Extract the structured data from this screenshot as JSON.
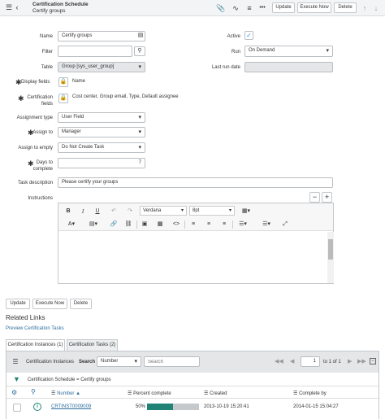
{
  "header": {
    "menu_icon": "hamburger-icon",
    "back_icon": "chevron-left-icon",
    "title": "Certification Schedule",
    "subtitle": "Certify groups",
    "icons": [
      "paperclip-icon",
      "activity-icon",
      "sliders-icon",
      "more-icon"
    ],
    "update_label": "Update",
    "execute_label": "Execute Now",
    "delete_label": "Delete"
  },
  "form": {
    "name_label": "Name",
    "name_value": "Certify groups",
    "active_label": "Active",
    "active_checked": true,
    "filter_label": "Filter",
    "filter_value": "",
    "run_label": "Run",
    "run_value": "On Demand",
    "table_label": "Table",
    "table_value": "Group [sys_user_group]",
    "last_run_label": "Last run date",
    "last_run_value": "",
    "display_fields_label": "Display fields",
    "display_fields_value": "Name",
    "cert_fields_label_1": "Certification",
    "cert_fields_label_2": "fields",
    "cert_fields_value": "Cost center, Group email, Type, Default assignee",
    "assignment_type_label": "Assignment type",
    "assignment_type_value": "User Field",
    "assign_to_label": "Assign to",
    "assign_to_value": "Manager",
    "assign_empty_label": "Assign to empty",
    "assign_empty_value": "Do Not Create Task",
    "days_label_1": "Days to",
    "days_label_2": "complete",
    "days_value": "7",
    "task_desc_label": "Task description",
    "task_desc_value": "Please certify your groups",
    "instructions_label": "Instructions"
  },
  "editor": {
    "font_value": "Verdana",
    "size_value": "8pt",
    "toolbar_icons": [
      "bold-icon",
      "italic-icon",
      "underline-icon",
      "undo-icon",
      "redo-icon",
      "text-color-icon",
      "bg-color-icon",
      "link-icon",
      "unlink-icon",
      "image-icon",
      "media-icon",
      "code-icon",
      "align-left-icon",
      "align-center-icon",
      "align-right-icon",
      "bullet-list-icon",
      "number-list-icon",
      "fullscreen-icon"
    ],
    "table_icon": "table-icon"
  },
  "bottom_buttons": {
    "update_label": "Update",
    "execute_label": "Execute Now",
    "delete_label": "Delete"
  },
  "related": {
    "title": "Related Links",
    "preview_link": "Preview Certification Tasks"
  },
  "tabs": [
    {
      "label": "Certification Instances (1)",
      "active": true
    },
    {
      "label": "Certification Tasks (2)",
      "active": false
    }
  ],
  "list": {
    "menu_icon": "hamburger-icon",
    "title": "Certification Instances",
    "search_label": "Search",
    "search_field": "Number",
    "search_placeholder": "Search",
    "page_value": "1",
    "page_total": "to 1 of 1",
    "breadcrumb": "Certification Schedule = Certify groups",
    "columns": [
      "Number",
      "Percent complete",
      "Created",
      "Complete by"
    ],
    "sort_arrow": "▲",
    "rows": [
      {
        "number": "CRTINST0009009",
        "percent_label": "50%",
        "percent": 0.5,
        "created": "2013-10-19 15:20:41",
        "complete_by": "2014-01-15 15:04:27"
      }
    ]
  },
  "colors": {
    "accent": "#278efc",
    "progress": "#1f8476",
    "link": "#2e6e9e",
    "check": "#278efc"
  }
}
